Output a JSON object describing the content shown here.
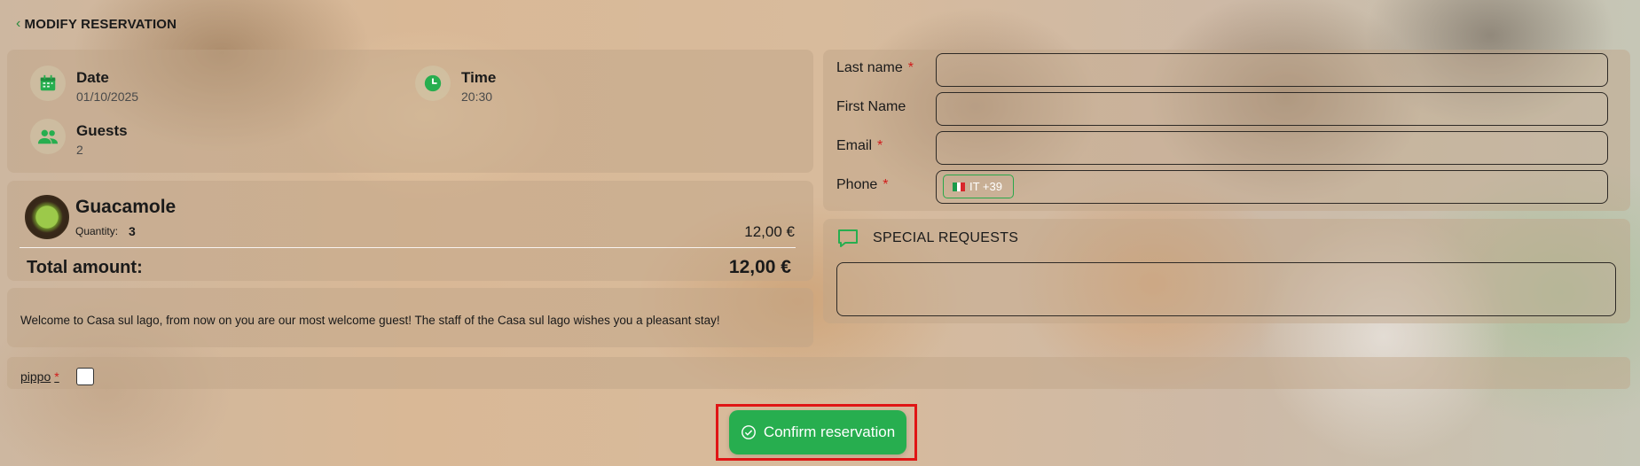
{
  "header": {
    "back_label": "MODIFY RESERVATION"
  },
  "reservation": {
    "date_label": "Date",
    "date_value": "01/10/2025",
    "time_label": "Time",
    "time_value": "20:30",
    "guests_label": "Guests",
    "guests_value": "2"
  },
  "order": {
    "dish_name": "Guacamole",
    "quantity_label": "Quantity:",
    "quantity_value": "3",
    "item_price": "12,00 €",
    "total_label": "Total amount:",
    "total_value": "12,00 €"
  },
  "welcome_message": "Welcome to Casa sul lago, from now on you are our most welcome guest! The staff of the Casa sul lago wishes you a pleasant stay!",
  "form": {
    "last_name_label": "Last name",
    "last_name_value": "",
    "first_name_label": "First Name",
    "first_name_value": "",
    "email_label": "Email",
    "email_value": "",
    "phone_label": "Phone",
    "phone_value": "",
    "phone_prefix": "IT +39",
    "required_mark": "*"
  },
  "special_requests": {
    "title": "SPECIAL REQUESTS",
    "value": ""
  },
  "consent": {
    "label": "pippo",
    "checked": false
  },
  "confirm_button": {
    "label": "Confirm reservation"
  },
  "colors": {
    "accent": "#27ae4f",
    "required": "#d11a1a",
    "highlight": "#e01515"
  },
  "icons": [
    "chevron-left-icon",
    "calendar-icon",
    "clock-icon",
    "people-icon",
    "chat-bubble-icon",
    "check-circle-icon",
    "italy-flag-icon"
  ]
}
